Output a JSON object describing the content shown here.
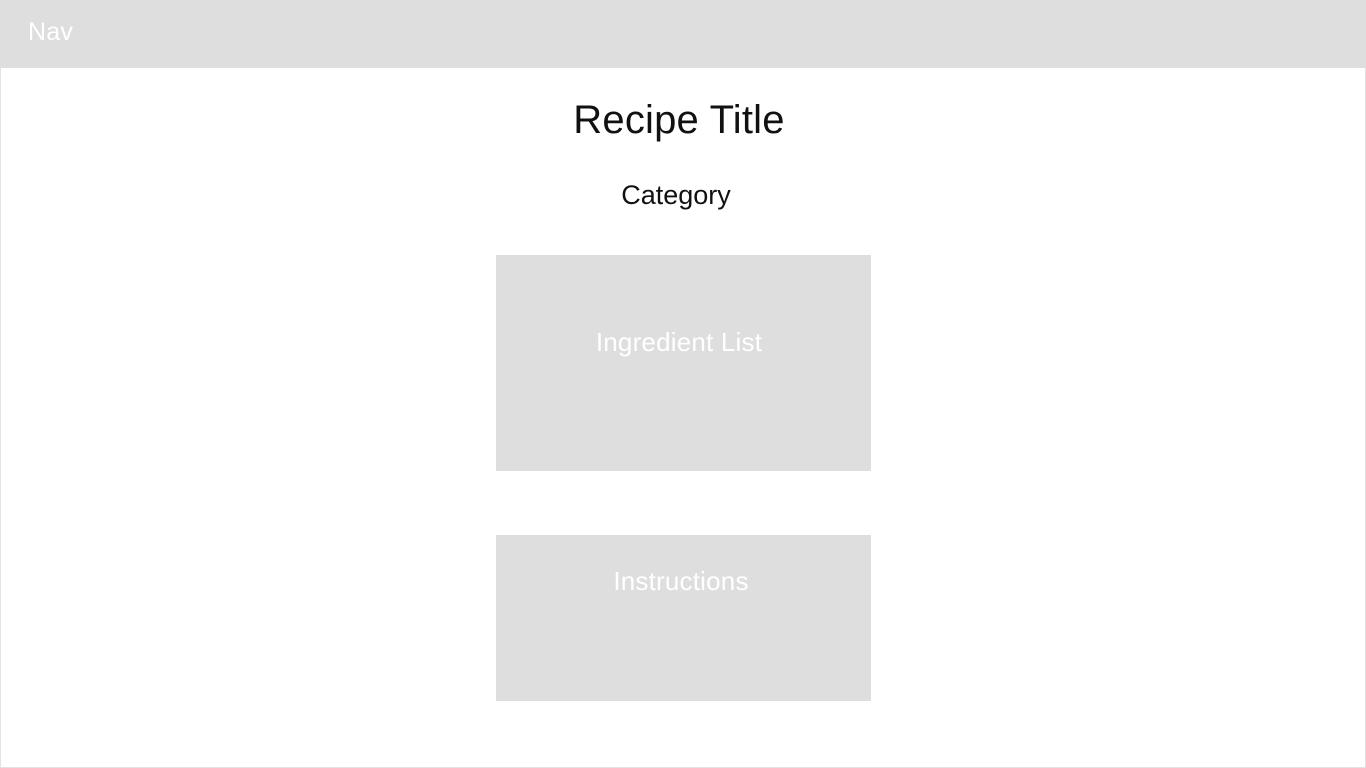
{
  "nav": {
    "label": "Nav"
  },
  "recipe": {
    "title": "Recipe Title",
    "category": "Category"
  },
  "sections": {
    "ingredients_label": "Ingredient List",
    "instructions_label": "Instructions"
  },
  "colors": {
    "placeholder_fill": "#dedede",
    "placeholder_text": "#ffffff",
    "heading_text": "#111111",
    "background": "#ffffff"
  }
}
